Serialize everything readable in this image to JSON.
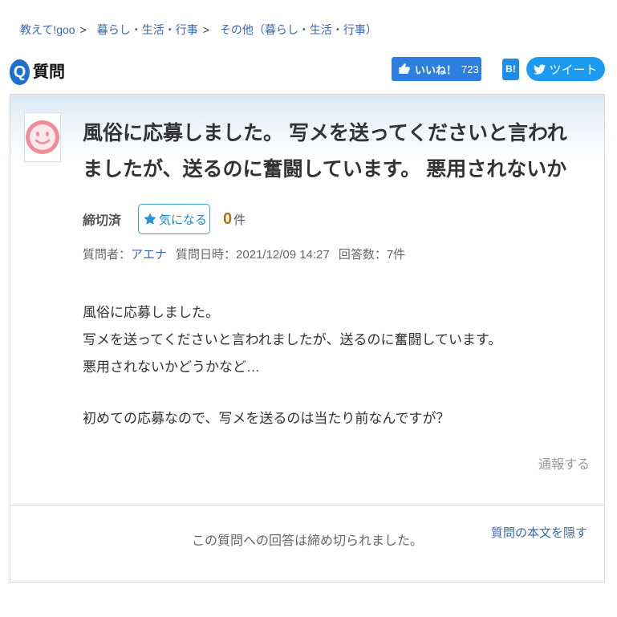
{
  "breadcrumb": {
    "separator": ">",
    "items": [
      {
        "label": "教えて!goo"
      },
      {
        "label": "暮らし・生活・行事"
      },
      {
        "label": "その他（暮らし・生活・行事）"
      }
    ]
  },
  "header": {
    "q_icon_label": "Q",
    "title": "質問",
    "like_button": {
      "icon": "thumbs-up-icon",
      "label": "いいね！",
      "count": "723"
    },
    "hatena_button": {
      "label": "B!"
    },
    "tweet_button": {
      "icon": "twitter-bird-icon",
      "label": "ツイート"
    }
  },
  "question": {
    "avatar_icon": "smiley-face-icon",
    "title": "風俗に応募しました。 写メを送ってくださいと言われましたが、送るのに奮闘しています。 悪用されないか",
    "status": "締切済",
    "watch_button": {
      "icon": "star-icon",
      "label": "気になる"
    },
    "watch_count": "0",
    "watch_count_unit": "件",
    "meta": {
      "asker_label": "質問者：",
      "asker_name": "アエナ",
      "date_label": "質問日時：",
      "date_value": "2021/12/09 14:27",
      "answers_label": "回答数：",
      "answers_value": "7件"
    },
    "body": {
      "paragraphs": [
        {
          "lines": [
            "風俗に応募しました。",
            "写メを送ってくださいと言われましたが、送るのに奮闘しています。",
            "悪用されないかどうかなど…"
          ]
        },
        {
          "lines": [
            "初めての応募なので、写メを送るのは当たり前なんですが？"
          ]
        }
      ]
    },
    "report_link": "通報する"
  },
  "footer": {
    "closed_message": "この質問への回答は締め切られました。",
    "hide_body_link": "質問の本文を隠す"
  },
  "colors": {
    "link": "#3b67b0",
    "q_icon": "#1f6fd0",
    "like_button": "#2c7fdf",
    "hatena_button": "#1e8de6",
    "tweet_button": "#1d9bf0",
    "watch_button": "#3aa0dc",
    "watch_count": "#b0720c",
    "avatar": "#f08c99"
  }
}
